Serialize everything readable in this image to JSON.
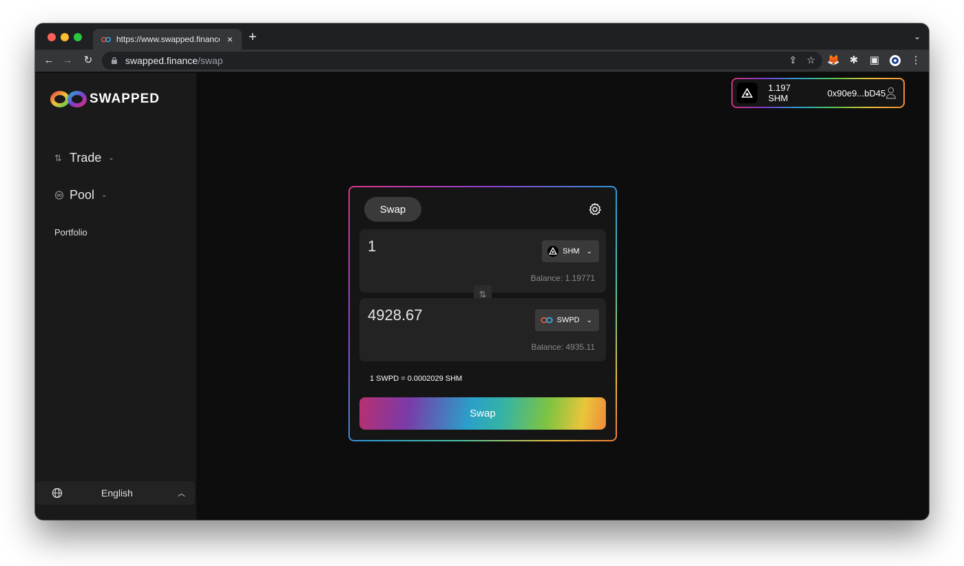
{
  "browser": {
    "tab_title": "https://www.swapped.finance/",
    "url_host": "swapped.finance",
    "url_path": "/swap"
  },
  "app": {
    "logo_text": "SWAPPED",
    "colors": {
      "background": "#0d0d0d",
      "sidebar": "#1a1a1a",
      "card": "#151515",
      "accent_gradient": [
        "#d1307a",
        "#7a3fd6",
        "#2aa7ce",
        "#5ec94f",
        "#f0c23a",
        "#ef8d35"
      ]
    }
  },
  "sidebar": {
    "items": [
      {
        "label": "Trade",
        "icon": "swap-arrows-icon"
      },
      {
        "label": "Pool",
        "icon": "pool-icon"
      },
      {
        "label": "Portfolio"
      }
    ],
    "language": "English"
  },
  "wallet": {
    "balance": "1.197 SHM",
    "address": "0x90e9...bD45"
  },
  "swap": {
    "tab_label": "Swap",
    "from": {
      "amount": "1",
      "token": "SHM",
      "balance": "Balance: 1.19771"
    },
    "to": {
      "amount": "4928.67",
      "token": "SWPD",
      "balance": "Balance: 4935.11"
    },
    "rate": "1 SWPD = 0.0002029 SHM",
    "button_label": "Swap"
  }
}
